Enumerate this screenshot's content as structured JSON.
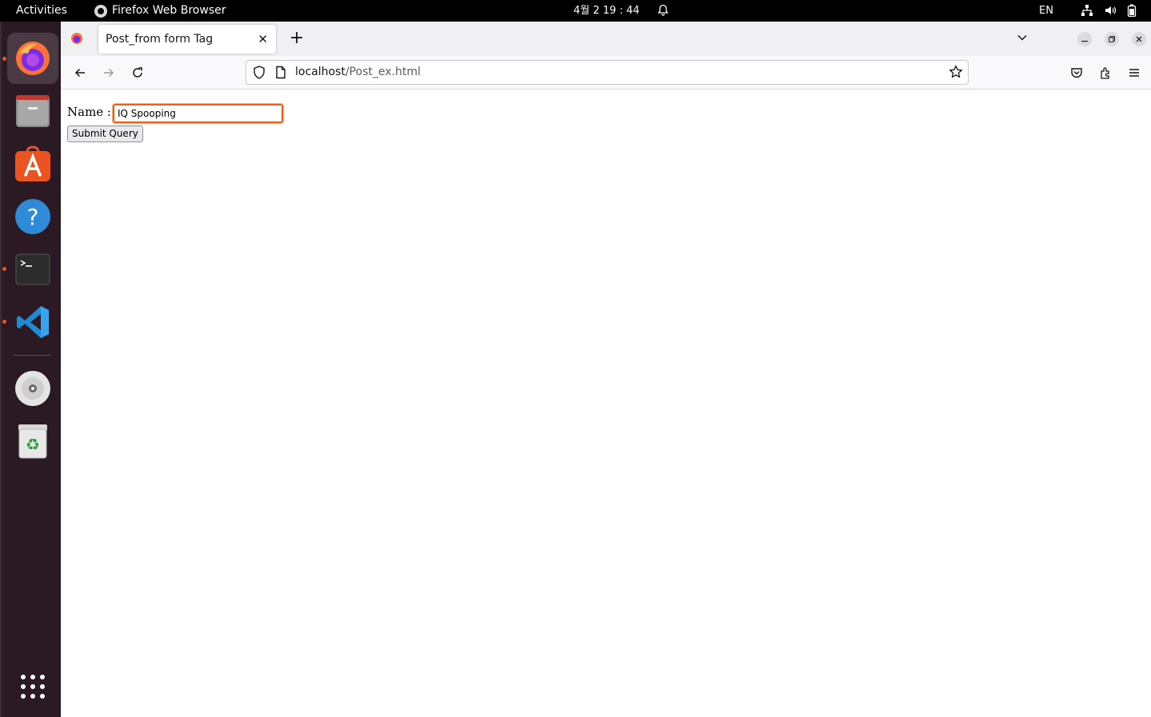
{
  "topbar": {
    "activities": "Activities",
    "app_name": "Firefox Web Browser",
    "clock": "4월 2  19 : 44",
    "language": "EN",
    "icons": [
      "bell-icon",
      "network-icon",
      "volume-icon",
      "battery-icon"
    ]
  },
  "dock": {
    "items": [
      "firefox",
      "files",
      "app-center",
      "help",
      "terminal",
      "vscode",
      "disc",
      "trash",
      "show-apps"
    ],
    "accent": "#e95420"
  },
  "browser": {
    "tab_title": "Post_from form Tag",
    "tab_close": "✕",
    "new_tab": "+",
    "url_host": "localhost",
    "url_path": "/Post_ex.html"
  },
  "page": {
    "name_label": "Name :",
    "name_value": "IQ Spooping",
    "submit_label": "Submit Query"
  }
}
